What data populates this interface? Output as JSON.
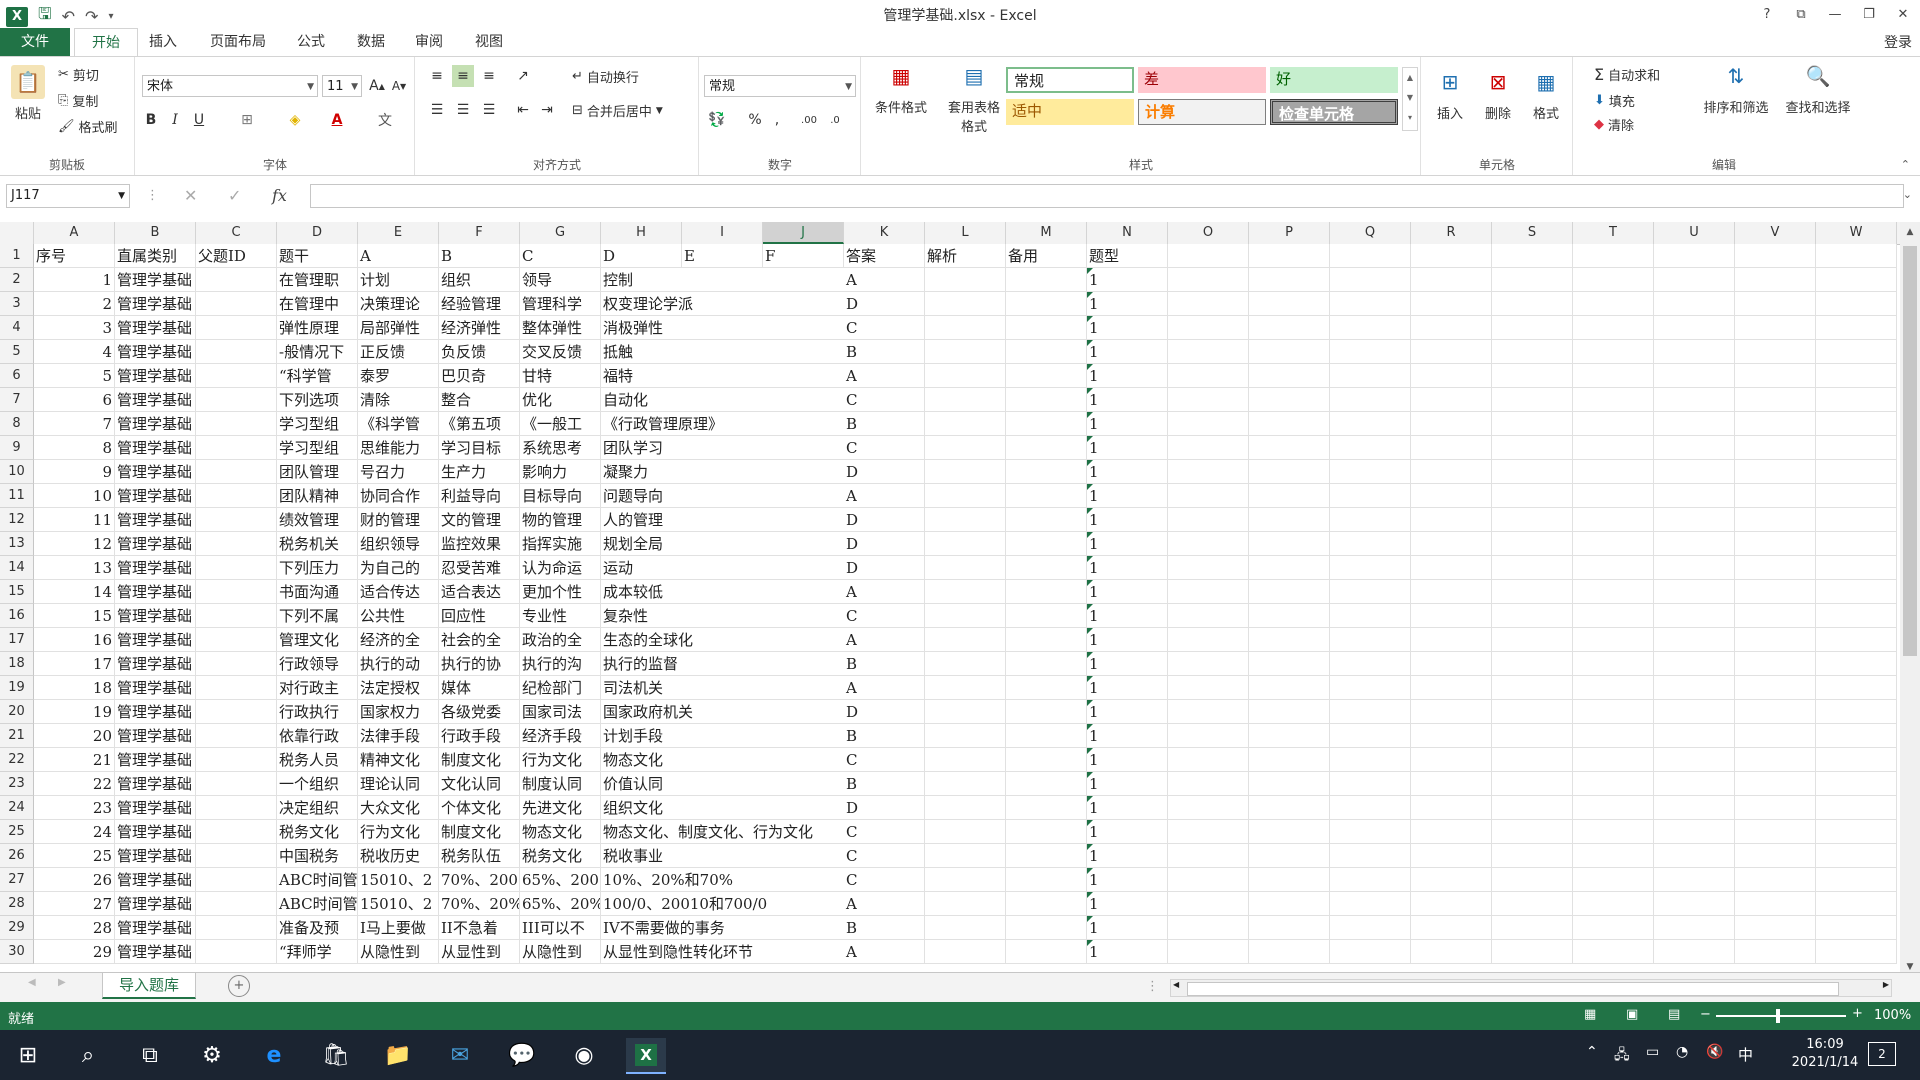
{
  "window": {
    "title": "管理学基础.xlsx - Excel",
    "help": "?",
    "signin": "登录"
  },
  "tabs": [
    "文件",
    "开始",
    "插入",
    "页面布局",
    "公式",
    "数据",
    "审阅",
    "视图"
  ],
  "ribbon": {
    "clipboard": {
      "paste": "粘贴",
      "cut": "剪切",
      "copy": "复制",
      "format_painter": "格式刷",
      "label": "剪贴板"
    },
    "font": {
      "name": "宋体",
      "size": "11",
      "bold": "B",
      "italic": "I",
      "underline": "U",
      "label": "字体"
    },
    "alignment": {
      "wrap": "自动换行",
      "merge": "合并后居中",
      "label": "对齐方式"
    },
    "number": {
      "format": "常规",
      "percent": "%",
      "comma": ",",
      "label": "数字"
    },
    "styles": {
      "conditional": "条件格式",
      "table_format": "套用表格格式",
      "normal": "常规",
      "bad": "差",
      "good": "好",
      "neutral": "适中",
      "calculation": "计算",
      "check_cell": "检查单元格",
      "label": "样式"
    },
    "cells": {
      "insert": "插入",
      "delete": "删除",
      "format": "格式",
      "label": "单元格"
    },
    "editing": {
      "autosum": "自动求和",
      "fill": "填充",
      "clear": "清除",
      "sort": "排序和筛选",
      "find": "查找和选择",
      "label": "编辑"
    }
  },
  "formula_bar": {
    "name_box": "J117",
    "fx": "fx",
    "value": ""
  },
  "columns": [
    "A",
    "B",
    "C",
    "D",
    "E",
    "F",
    "G",
    "H",
    "I",
    "J",
    "K",
    "L",
    "M",
    "N",
    "O",
    "P",
    "Q",
    "R",
    "S",
    "T",
    "U",
    "V",
    "W"
  ],
  "selected_column": "J",
  "header_row": [
    "序号",
    "直属类别",
    "父题ID",
    "题干",
    "A",
    "B",
    "C",
    "D",
    "E",
    "F",
    "答案",
    "解析",
    "备用",
    "题型"
  ],
  "rows": [
    {
      "n": "1",
      "cat": "管理学基础",
      "stem": "在管理职",
      "a": "计划",
      "b": "组织",
      "c": "领导",
      "d": "控制",
      "ans": "A",
      "type": "1"
    },
    {
      "n": "2",
      "cat": "管理学基础",
      "stem": "在管理中",
      "a": "决策理论",
      "b": "经验管理",
      "c": "管理科学",
      "d": "权变理论学派",
      "ans": "D",
      "type": "1"
    },
    {
      "n": "3",
      "cat": "管理学基础",
      "stem": "弹性原理",
      "a": "局部弹性",
      "b": "经济弹性",
      "c": "整体弹性",
      "d": "消极弹性",
      "ans": "C",
      "type": "1"
    },
    {
      "n": "4",
      "cat": "管理学基础",
      "stem": "-般情况下",
      "a": "正反馈",
      "b": "负反馈",
      "c": "交叉反馈",
      "d": "抵触",
      "ans": "B",
      "type": "1"
    },
    {
      "n": "5",
      "cat": "管理学基础",
      "stem": "“科学管",
      "a": "泰罗",
      "b": "巴贝奇",
      "c": "甘特",
      "d": "福特",
      "ans": "A",
      "type": "1"
    },
    {
      "n": "6",
      "cat": "管理学基础",
      "stem": "下列选项",
      "a": "清除",
      "b": "整合",
      "c": "优化",
      "d": "自动化",
      "ans": "C",
      "type": "1"
    },
    {
      "n": "7",
      "cat": "管理学基础",
      "stem": "学习型组",
      "a": "《科学管",
      "b": "《第五项",
      "c": "《一般工",
      "d": "《行政管理原理》",
      "ans": "B",
      "type": "1"
    },
    {
      "n": "8",
      "cat": "管理学基础",
      "stem": "学习型组",
      "a": "思维能力",
      "b": "学习目标",
      "c": "系统思考",
      "d": "团队学习",
      "ans": "C",
      "type": "1"
    },
    {
      "n": "9",
      "cat": "管理学基础",
      "stem": "团队管理",
      "a": "号召力",
      "b": "生产力",
      "c": "影响力",
      "d": "凝聚力",
      "ans": "D",
      "type": "1"
    },
    {
      "n": "10",
      "cat": "管理学基础",
      "stem": "团队精神",
      "a": "协同合作",
      "b": "利益导向",
      "c": "目标导向",
      "d": "问题导向",
      "ans": "A",
      "type": "1"
    },
    {
      "n": "11",
      "cat": "管理学基础",
      "stem": "绩效管理",
      "a": "财的管理",
      "b": "文的管理",
      "c": "物的管理",
      "d": "人的管理",
      "ans": "D",
      "type": "1"
    },
    {
      "n": "12",
      "cat": "管理学基础",
      "stem": "税务机关",
      "a": "组织领导",
      "b": "监控效果",
      "c": "指挥实施",
      "d": "规划全局",
      "ans": "D",
      "type": "1"
    },
    {
      "n": "13",
      "cat": "管理学基础",
      "stem": "下列压力",
      "a": "为自己的",
      "b": "忍受苦难",
      "c": "认为命运",
      "d": "运动",
      "ans": "D",
      "type": "1"
    },
    {
      "n": "14",
      "cat": "管理学基础",
      "stem": "书面沟通",
      "a": "适合传达",
      "b": "适合表达",
      "c": "更加个性",
      "d": "成本较低",
      "ans": "A",
      "type": "1"
    },
    {
      "n": "15",
      "cat": "管理学基础",
      "stem": "下列不属",
      "a": "公共性",
      "b": "回应性",
      "c": "专业性",
      "d": "复杂性",
      "ans": "C",
      "type": "1"
    },
    {
      "n": "16",
      "cat": "管理学基础",
      "stem": "管理文化",
      "a": "经济的全",
      "b": "社会的全",
      "c": "政治的全",
      "d": "生态的全球化",
      "ans": "A",
      "type": "1"
    },
    {
      "n": "17",
      "cat": "管理学基础",
      "stem": "行政领导",
      "a": "执行的动",
      "b": "执行的协",
      "c": "执行的沟",
      "d": "执行的监督",
      "ans": "B",
      "type": "1"
    },
    {
      "n": "18",
      "cat": "管理学基础",
      "stem": "对行政主",
      "a": "法定授权",
      "b": "媒体",
      "c": "纪检部门",
      "d": "司法机关",
      "ans": "A",
      "type": "1"
    },
    {
      "n": "19",
      "cat": "管理学基础",
      "stem": "行政执行",
      "a": "国家权力",
      "b": "各级党委",
      "c": "国家司法",
      "d": "国家政府机关",
      "ans": "D",
      "type": "1"
    },
    {
      "n": "20",
      "cat": "管理学基础",
      "stem": "依靠行政",
      "a": "法律手段",
      "b": "行政手段",
      "c": "经济手段",
      "d": "计划手段",
      "ans": "B",
      "type": "1"
    },
    {
      "n": "21",
      "cat": "管理学基础",
      "stem": "税务人员",
      "a": "精神文化",
      "b": "制度文化",
      "c": "行为文化",
      "d": "物态文化",
      "ans": "C",
      "type": "1"
    },
    {
      "n": "22",
      "cat": "管理学基础",
      "stem": "一个组织",
      "a": "理论认同",
      "b": "文化认同",
      "c": "制度认同",
      "d": "价值认同",
      "ans": "B",
      "type": "1"
    },
    {
      "n": "23",
      "cat": "管理学基础",
      "stem": "决定组织",
      "a": "大众文化",
      "b": "个体文化",
      "c": "先进文化",
      "d": "组织文化",
      "ans": "D",
      "type": "1"
    },
    {
      "n": "24",
      "cat": "管理学基础",
      "stem": "税务文化",
      "a": "行为文化",
      "b": "制度文化",
      "c": "物态文化",
      "d": "物态文化、制度文化、行为文化",
      "ans": "C",
      "type": "1"
    },
    {
      "n": "25",
      "cat": "管理学基础",
      "stem": "中国税务",
      "a": "税收历史",
      "b": "税务队伍",
      "c": "税务文化",
      "d": "税收事业",
      "ans": "C",
      "type": "1"
    },
    {
      "n": "26",
      "cat": "管理学基础",
      "stem": "ABC时间管",
      "a": "15010、2",
      "b": "70%、200",
      "c": "65%、200",
      "d": "10%、20%和70%",
      "ans": "C",
      "type": "1"
    },
    {
      "n": "27",
      "cat": "管理学基础",
      "stem": "ABC时间管",
      "a": "15010、2",
      "b": "70%、20%",
      "c": "65%、20%",
      "d": "100/0、20010和700/0",
      "ans": "A",
      "type": "1"
    },
    {
      "n": "28",
      "cat": "管理学基础",
      "stem": "准备及预",
      "a": "I马上要做",
      "b": "II不急着",
      "c": "III可以不",
      "d": "IV不需要做的事务",
      "ans": "B",
      "type": "1"
    },
    {
      "n": "29",
      "cat": "管理学基础",
      "stem": "“拜师学",
      "a": "从隐性到",
      "b": "从显性到",
      "c": "从隐性到",
      "d": "从显性到隐性转化环节",
      "ans": "A",
      "type": "1"
    }
  ],
  "sheet_tab": "导入题库",
  "status": {
    "ready": "就绪",
    "zoom": "100%"
  },
  "taskbar": {
    "time": "16:09",
    "date": "2021/1/14",
    "ime": "中",
    "notifications": "2"
  }
}
